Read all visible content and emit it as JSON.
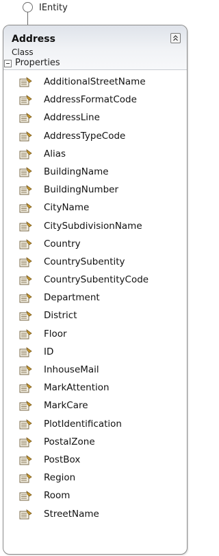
{
  "interface": {
    "name": "IEntity"
  },
  "class": {
    "name": "Address",
    "stereotype": "Class"
  },
  "section": {
    "label": "Properties"
  },
  "properties": [
    "AdditionalStreetName",
    "AddressFormatCode",
    "AddressLine",
    "AddressTypeCode",
    "Alias",
    "BuildingName",
    "BuildingNumber",
    "CityName",
    "CitySubdivisionName",
    "Country",
    "CountrySubentity",
    "CountrySubentityCode",
    "Department",
    "District",
    "Floor",
    "ID",
    "InhouseMail",
    "MarkAttention",
    "MarkCare",
    "PlotIdentification",
    "PostalZone",
    "PostBox",
    "Region",
    "Room",
    "StreetName"
  ],
  "icons": {
    "property": "property-icon",
    "collapse": "collapse-chevrons-icon",
    "section_toggle": "minus-box-icon",
    "interface": "lollipop-interface-icon"
  }
}
